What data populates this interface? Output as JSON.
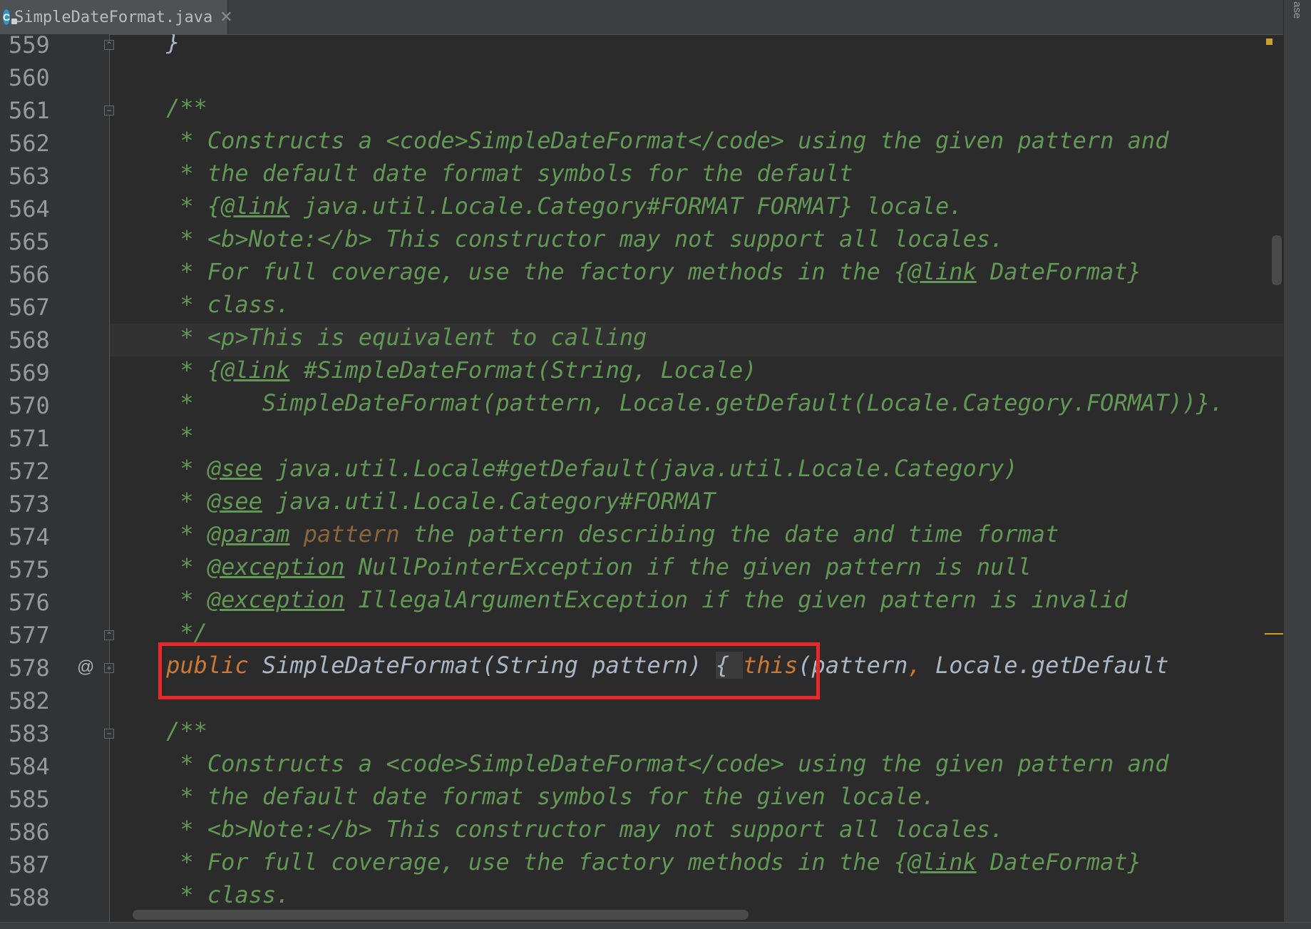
{
  "tab": {
    "icon_letter": "C",
    "label": "SimpleDateFormat.java",
    "close": "✕"
  },
  "right_strip": {
    "label": "ase"
  },
  "gutter": {
    "marker": "@"
  },
  "colors": {
    "background": "#2b2b2b",
    "gutter": "#313335",
    "doc_comment": "#629755",
    "keyword": "#cc7832",
    "plain": "#a9b7c6",
    "param": "#8a653b",
    "line_number": "#999999",
    "highlight_box": "#e8282b"
  },
  "lines": [
    {
      "num": "559",
      "fold": "up",
      "segments": [
        {
          "c": "t-brace",
          "t": "    }"
        }
      ]
    },
    {
      "num": "560",
      "segments": []
    },
    {
      "num": "561",
      "fold": "down",
      "segments": [
        {
          "c": "t-comment",
          "t": "    /**"
        }
      ]
    },
    {
      "num": "562",
      "segments": [
        {
          "c": "t-doc",
          "t": "     * Constructs a <code>SimpleDateFormat</code> using the given pattern and"
        }
      ]
    },
    {
      "num": "563",
      "segments": [
        {
          "c": "t-doc",
          "t": "     * the default date format symbols for the default"
        }
      ]
    },
    {
      "num": "564",
      "segments": [
        {
          "c": "t-doc",
          "t": "     * {"
        },
        {
          "c": "t-doctag",
          "t": "@link"
        },
        {
          "c": "t-doc",
          "t": " java.util.Locale.Category#FORMAT FORMAT} locale."
        }
      ]
    },
    {
      "num": "565",
      "segments": [
        {
          "c": "t-doc",
          "t": "     * <b>Note:</b> This constructor may not support all locales."
        }
      ]
    },
    {
      "num": "566",
      "segments": [
        {
          "c": "t-doc",
          "t": "     * For full coverage, use the factory methods in the {"
        },
        {
          "c": "t-doctag",
          "t": "@link"
        },
        {
          "c": "t-doc",
          "t": " DateFormat}"
        }
      ]
    },
    {
      "num": "567",
      "segments": [
        {
          "c": "t-doc",
          "t": "     * class."
        }
      ]
    },
    {
      "num": "568",
      "caret": true,
      "segments": [
        {
          "c": "t-doc",
          "t": "     * <p>This is equivalent to calling"
        }
      ]
    },
    {
      "num": "569",
      "segments": [
        {
          "c": "t-doc",
          "t": "     * {"
        },
        {
          "c": "t-doctag",
          "t": "@link"
        },
        {
          "c": "t-doc",
          "t": " #SimpleDateFormat(String, Locale)"
        }
      ]
    },
    {
      "num": "570",
      "segments": [
        {
          "c": "t-doc",
          "t": "     *     SimpleDateFormat(pattern, Locale.getDefault(Locale.Category.FORMAT))}."
        }
      ]
    },
    {
      "num": "571",
      "segments": [
        {
          "c": "t-doc",
          "t": "     *"
        }
      ]
    },
    {
      "num": "572",
      "segments": [
        {
          "c": "t-doc",
          "t": "     * "
        },
        {
          "c": "t-doctag",
          "t": "@see"
        },
        {
          "c": "t-doc",
          "t": " java.util.Locale#getDefault(java.util.Locale.Category)"
        }
      ]
    },
    {
      "num": "573",
      "segments": [
        {
          "c": "t-doc",
          "t": "     * "
        },
        {
          "c": "t-doctag",
          "t": "@see"
        },
        {
          "c": "t-doc",
          "t": " java.util.Locale.Category#FORMAT"
        }
      ]
    },
    {
      "num": "574",
      "segments": [
        {
          "c": "t-doc",
          "t": "     * "
        },
        {
          "c": "t-doctag",
          "t": "@param"
        },
        {
          "c": "t-param",
          "t": " pattern"
        },
        {
          "c": "t-doc",
          "t": " the pattern describing the date and time format"
        }
      ]
    },
    {
      "num": "575",
      "segments": [
        {
          "c": "t-doc",
          "t": "     * "
        },
        {
          "c": "t-doctag",
          "t": "@exception"
        },
        {
          "c": "t-doc",
          "t": " NullPointerException if the given pattern is null"
        }
      ]
    },
    {
      "num": "576",
      "segments": [
        {
          "c": "t-doc",
          "t": "     * "
        },
        {
          "c": "t-doctag",
          "t": "@exception"
        },
        {
          "c": "t-doc",
          "t": " IllegalArgumentException if the given pattern is invalid"
        }
      ]
    },
    {
      "num": "577",
      "fold": "up",
      "segments": [
        {
          "c": "t-doc",
          "t": "     */"
        }
      ]
    },
    {
      "num": "578",
      "fold": "plus",
      "at": true,
      "segments": [
        {
          "c": "t-kw",
          "t": "    public "
        },
        {
          "c": "t-plain",
          "t": "SimpleDateFormat(String pattern) "
        },
        {
          "c": "t-fold",
          "t": "{ "
        },
        {
          "c": "t-kw",
          "t": "this"
        },
        {
          "c": "t-plain",
          "t": "(pattern"
        },
        {
          "c": "t-comma",
          "t": ", "
        },
        {
          "c": "t-plain",
          "t": "Locale."
        },
        {
          "c": "t-call",
          "t": "getDefault"
        }
      ]
    },
    {
      "num": "582",
      "segments": []
    },
    {
      "num": "583",
      "fold": "down",
      "segments": [
        {
          "c": "t-comment",
          "t": "    /**"
        }
      ]
    },
    {
      "num": "584",
      "segments": [
        {
          "c": "t-doc",
          "t": "     * Constructs a <code>SimpleDateFormat</code> using the given pattern and"
        }
      ]
    },
    {
      "num": "585",
      "segments": [
        {
          "c": "t-doc",
          "t": "     * the default date format symbols for the given locale."
        }
      ]
    },
    {
      "num": "586",
      "segments": [
        {
          "c": "t-doc",
          "t": "     * <b>Note:</b> This constructor may not support all locales."
        }
      ]
    },
    {
      "num": "587",
      "segments": [
        {
          "c": "t-doc",
          "t": "     * For full coverage, use the factory methods in the {"
        },
        {
          "c": "t-doctag",
          "t": "@link"
        },
        {
          "c": "t-doc",
          "t": " DateFormat}"
        }
      ]
    },
    {
      "num": "588",
      "segments": [
        {
          "c": "t-doc",
          "t": "     * class."
        }
      ]
    }
  ]
}
